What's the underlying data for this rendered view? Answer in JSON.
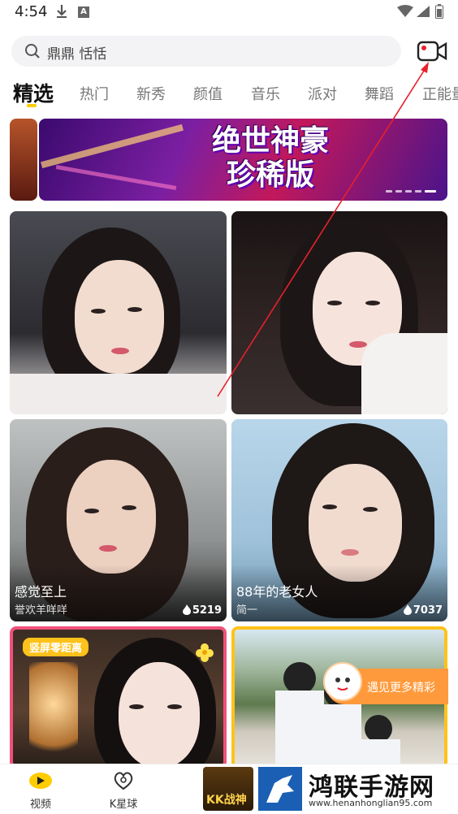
{
  "status_bar": {
    "time": "4:54",
    "icons": [
      "download-icon",
      "a-notification-icon",
      "wifi-icon",
      "signal-icon",
      "battery-icon"
    ]
  },
  "search": {
    "text": "鼎鼎 恬恬",
    "icon": "search-icon"
  },
  "camera_button": {
    "icon": "video-camera-icon",
    "accent": "#e8202a"
  },
  "tabs": [
    {
      "label": "精选",
      "active": true
    },
    {
      "label": "热门"
    },
    {
      "label": "新秀"
    },
    {
      "label": "颜值"
    },
    {
      "label": "音乐"
    },
    {
      "label": "派对"
    },
    {
      "label": "舞蹈"
    },
    {
      "label": "正能量"
    }
  ],
  "banner": {
    "title_line1": "绝世神豪",
    "title_line2": "珍稀版"
  },
  "cards": [
    {
      "title": "",
      "sub": "",
      "heat": ""
    },
    {
      "title": "",
      "sub": "",
      "heat": ""
    },
    {
      "title": "感觉至上",
      "sub": "誉欢羊咩咩",
      "heat": "5219"
    },
    {
      "title": "88年的老女人",
      "sub": "简一",
      "heat": "7037"
    },
    {
      "tag": "竖屏零距离"
    },
    {
      "title": ""
    }
  ],
  "promo": {
    "text": "遇见更多精彩"
  },
  "bottom_nav": [
    {
      "label": "视频",
      "icon": "video-icon"
    },
    {
      "label": "K星球",
      "icon": "heart-planet-icon"
    }
  ],
  "overlay": {
    "kk_text": "KK战神",
    "watermark_name": "鸿联手游网",
    "watermark_url": "www.henanhonglian95.com"
  },
  "colors": {
    "accent": "#ffcc00",
    "red": "#e8202a",
    "tag": "#ffc21a",
    "promo": "#ff9a3c"
  }
}
